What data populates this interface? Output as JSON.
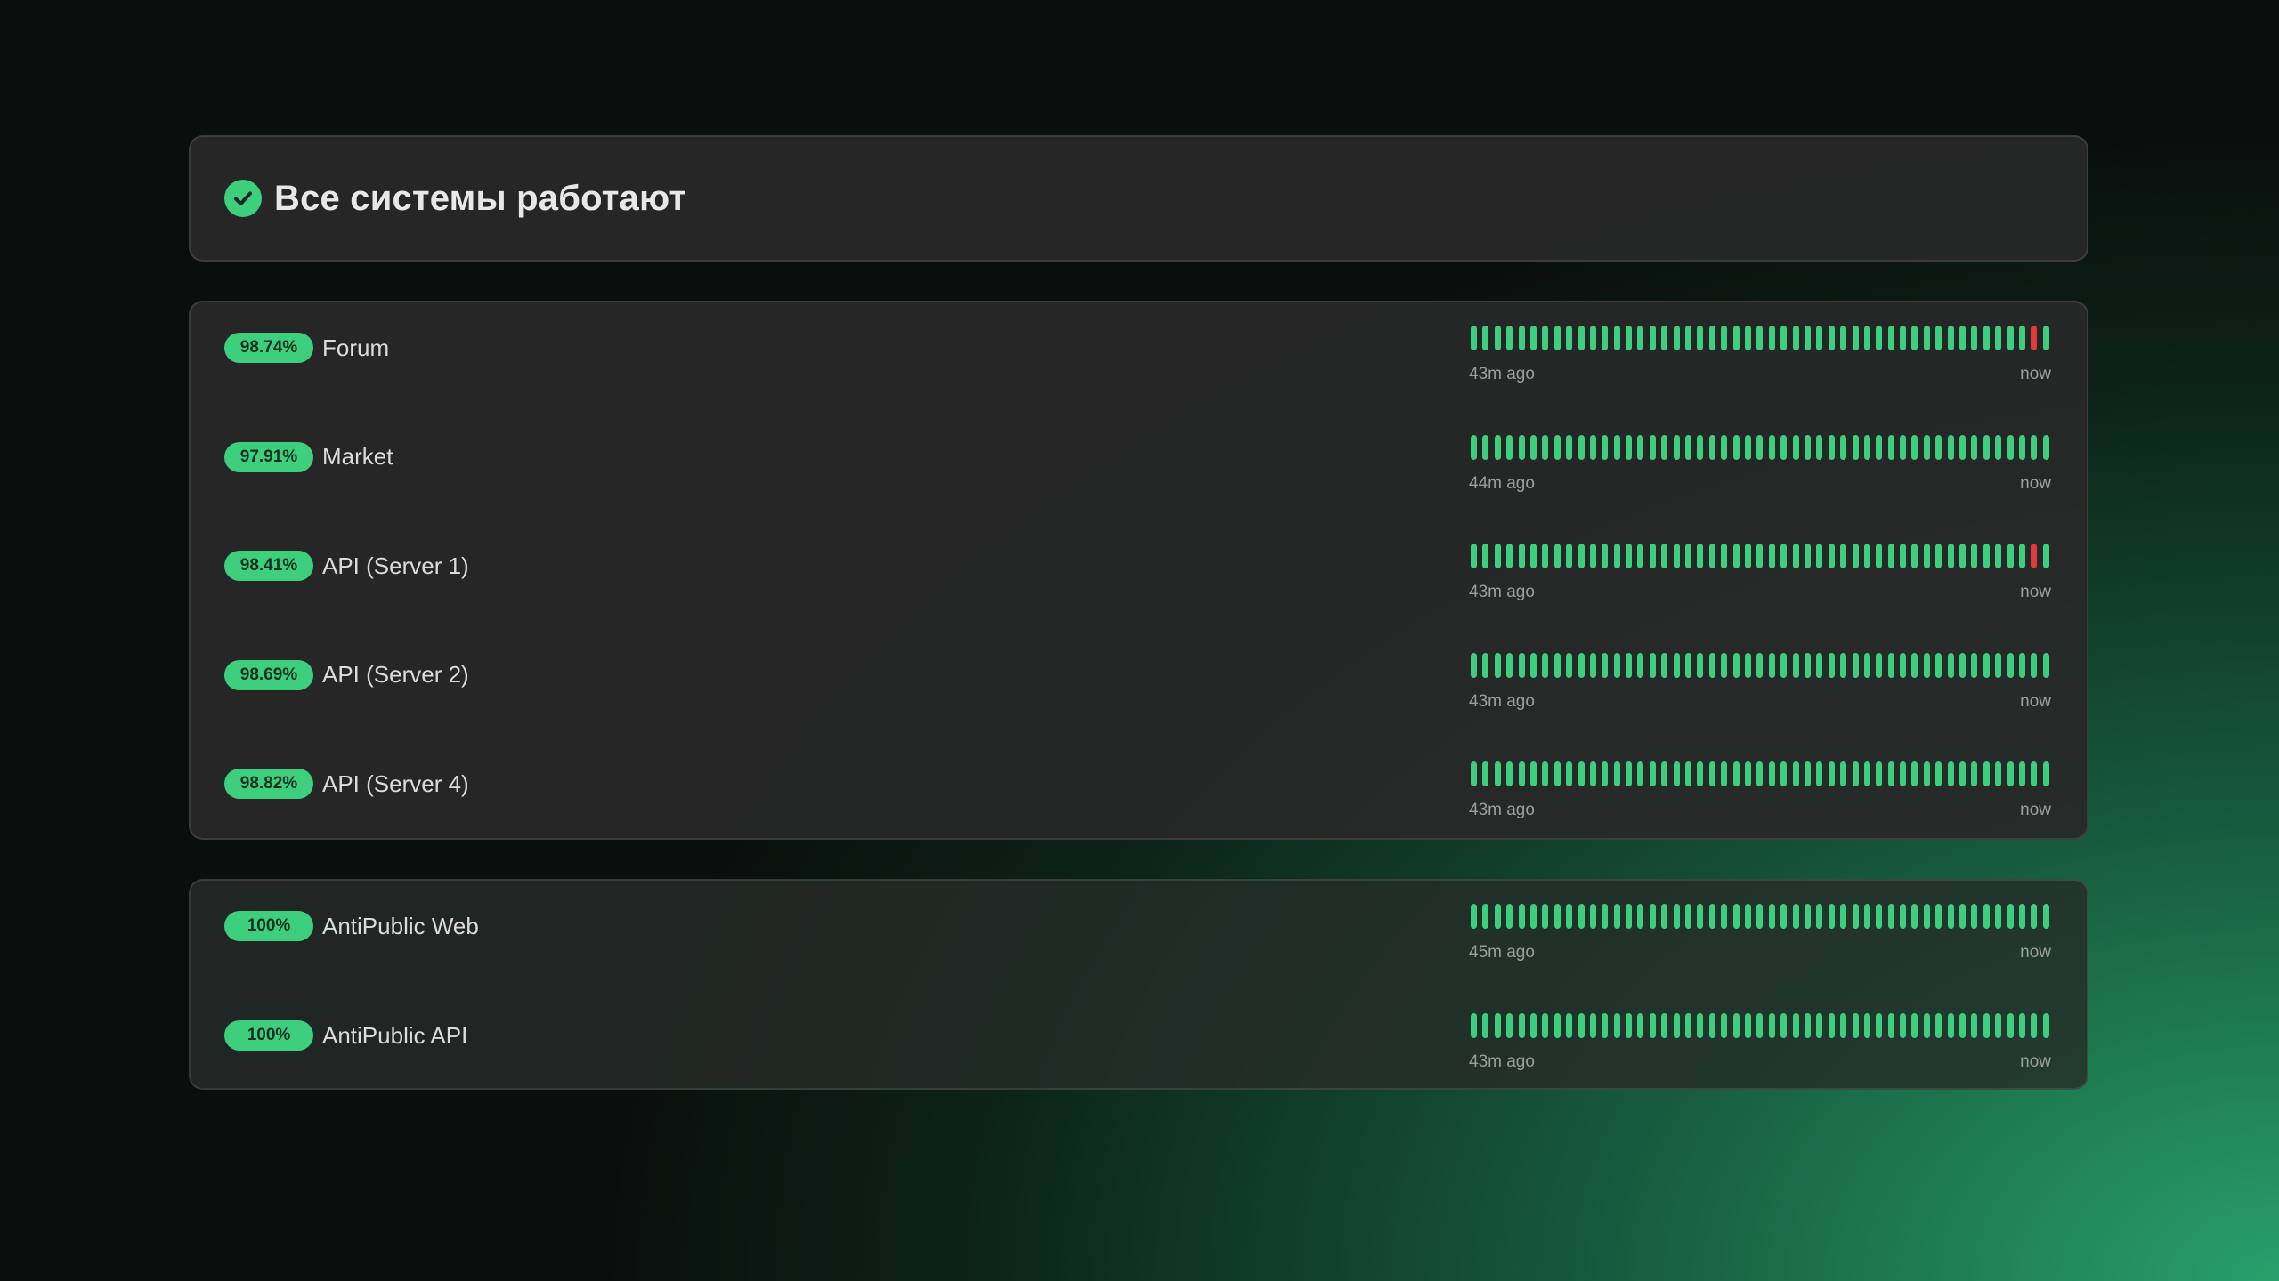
{
  "status": {
    "overall_text": "Все системы работают",
    "accent_color": "#3ecf7e",
    "down_color": "#e03a3a"
  },
  "groups": [
    {
      "monitors": [
        {
          "uptime": "98.74%",
          "name": "Forum",
          "time_start": "43m ago",
          "time_end": "now",
          "beats": [
            1,
            1,
            1,
            1,
            1,
            1,
            1,
            1,
            1,
            1,
            1,
            1,
            1,
            1,
            1,
            1,
            1,
            1,
            1,
            1,
            1,
            1,
            1,
            1,
            1,
            1,
            1,
            1,
            1,
            1,
            1,
            1,
            1,
            1,
            1,
            1,
            1,
            1,
            1,
            1,
            1,
            1,
            1,
            1,
            1,
            1,
            1,
            0,
            1
          ]
        },
        {
          "uptime": "97.91%",
          "name": "Market",
          "time_start": "44m ago",
          "time_end": "now",
          "beats": [
            1,
            1,
            1,
            1,
            1,
            1,
            1,
            1,
            1,
            1,
            1,
            1,
            1,
            1,
            1,
            1,
            1,
            1,
            1,
            1,
            1,
            1,
            1,
            1,
            1,
            1,
            1,
            1,
            1,
            1,
            1,
            1,
            1,
            1,
            1,
            1,
            1,
            1,
            1,
            1,
            1,
            1,
            1,
            1,
            1,
            1,
            1,
            1,
            1
          ]
        },
        {
          "uptime": "98.41%",
          "name": "API (Server 1)",
          "time_start": "43m ago",
          "time_end": "now",
          "beats": [
            1,
            1,
            1,
            1,
            1,
            1,
            1,
            1,
            1,
            1,
            1,
            1,
            1,
            1,
            1,
            1,
            1,
            1,
            1,
            1,
            1,
            1,
            1,
            1,
            1,
            1,
            1,
            1,
            1,
            1,
            1,
            1,
            1,
            1,
            1,
            1,
            1,
            1,
            1,
            1,
            1,
            1,
            1,
            1,
            1,
            1,
            1,
            0,
            1
          ]
        },
        {
          "uptime": "98.69%",
          "name": "API (Server 2)",
          "time_start": "43m ago",
          "time_end": "now",
          "beats": [
            1,
            1,
            1,
            1,
            1,
            1,
            1,
            1,
            1,
            1,
            1,
            1,
            1,
            1,
            1,
            1,
            1,
            1,
            1,
            1,
            1,
            1,
            1,
            1,
            1,
            1,
            1,
            1,
            1,
            1,
            1,
            1,
            1,
            1,
            1,
            1,
            1,
            1,
            1,
            1,
            1,
            1,
            1,
            1,
            1,
            1,
            1,
            1,
            1
          ]
        },
        {
          "uptime": "98.82%",
          "name": "API (Server 4)",
          "time_start": "43m ago",
          "time_end": "now",
          "beats": [
            1,
            1,
            1,
            1,
            1,
            1,
            1,
            1,
            1,
            1,
            1,
            1,
            1,
            1,
            1,
            1,
            1,
            1,
            1,
            1,
            1,
            1,
            1,
            1,
            1,
            1,
            1,
            1,
            1,
            1,
            1,
            1,
            1,
            1,
            1,
            1,
            1,
            1,
            1,
            1,
            1,
            1,
            1,
            1,
            1,
            1,
            1,
            1,
            1
          ]
        }
      ]
    },
    {
      "monitors": [
        {
          "uptime": "100%",
          "name": "AntiPublic Web",
          "time_start": "45m ago",
          "time_end": "now",
          "beats": [
            1,
            1,
            1,
            1,
            1,
            1,
            1,
            1,
            1,
            1,
            1,
            1,
            1,
            1,
            1,
            1,
            1,
            1,
            1,
            1,
            1,
            1,
            1,
            1,
            1,
            1,
            1,
            1,
            1,
            1,
            1,
            1,
            1,
            1,
            1,
            1,
            1,
            1,
            1,
            1,
            1,
            1,
            1,
            1,
            1,
            1,
            1,
            1,
            1
          ]
        },
        {
          "uptime": "100%",
          "name": "AntiPublic API",
          "time_start": "43m ago",
          "time_end": "now",
          "beats": [
            1,
            1,
            1,
            1,
            1,
            1,
            1,
            1,
            1,
            1,
            1,
            1,
            1,
            1,
            1,
            1,
            1,
            1,
            1,
            1,
            1,
            1,
            1,
            1,
            1,
            1,
            1,
            1,
            1,
            1,
            1,
            1,
            1,
            1,
            1,
            1,
            1,
            1,
            1,
            1,
            1,
            1,
            1,
            1,
            1,
            1,
            1,
            1,
            1
          ]
        }
      ]
    }
  ]
}
